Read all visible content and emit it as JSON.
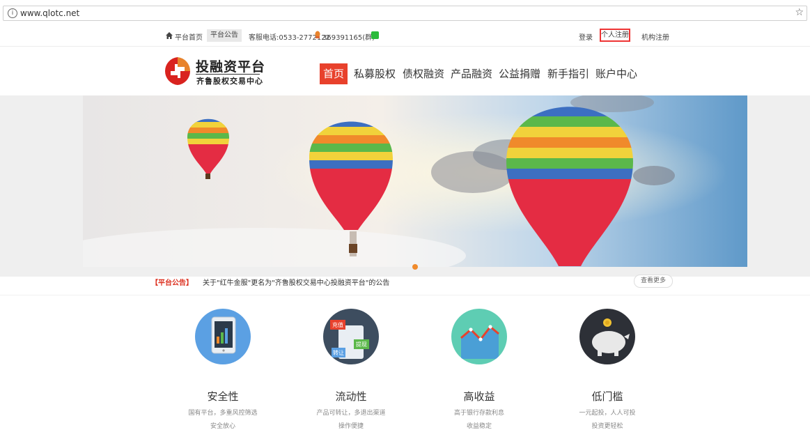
{
  "browser": {
    "url": "www.qlotc.net"
  },
  "topbar": {
    "home": "平台首页",
    "notice": "平台公告",
    "hotline": "客服电话:0533-2772122",
    "qq_group": "369391165(群)",
    "login": "登录",
    "register_personal": "个人注册",
    "register_org": "机构注册"
  },
  "logo": {
    "title": "投融资平台",
    "subtitle": "齐鲁股权交易中心"
  },
  "nav": [
    "首页",
    "私募股权",
    "债权融资",
    "产品融资",
    "公益捐赠",
    "新手指引",
    "账户中心"
  ],
  "notice_bar": {
    "label": "【平台公告】",
    "text": "关于\"红牛金服\"更名为\"齐鲁股权交易中心投融资平台\"的公告",
    "more": "查看更多"
  },
  "features": [
    {
      "title": "安全性",
      "line1": "国有平台，多重风控筛选",
      "line2": "安全放心",
      "icon": "tablet-chart-icon"
    },
    {
      "title": "流动性",
      "line1": "产品可转让，多退出渠道",
      "line2": "操作便捷",
      "icon": "exchange-icon",
      "tags": [
        "充值",
        "转让",
        "提现"
      ]
    },
    {
      "title": "高收益",
      "line1": "高于银行存款利息",
      "line2": "收益稳定",
      "icon": "growth-chart-icon"
    },
    {
      "title": "低门槛",
      "line1": "一元起投，人人可投",
      "line2": "投资更轻松",
      "icon": "piggy-bank-icon"
    }
  ]
}
